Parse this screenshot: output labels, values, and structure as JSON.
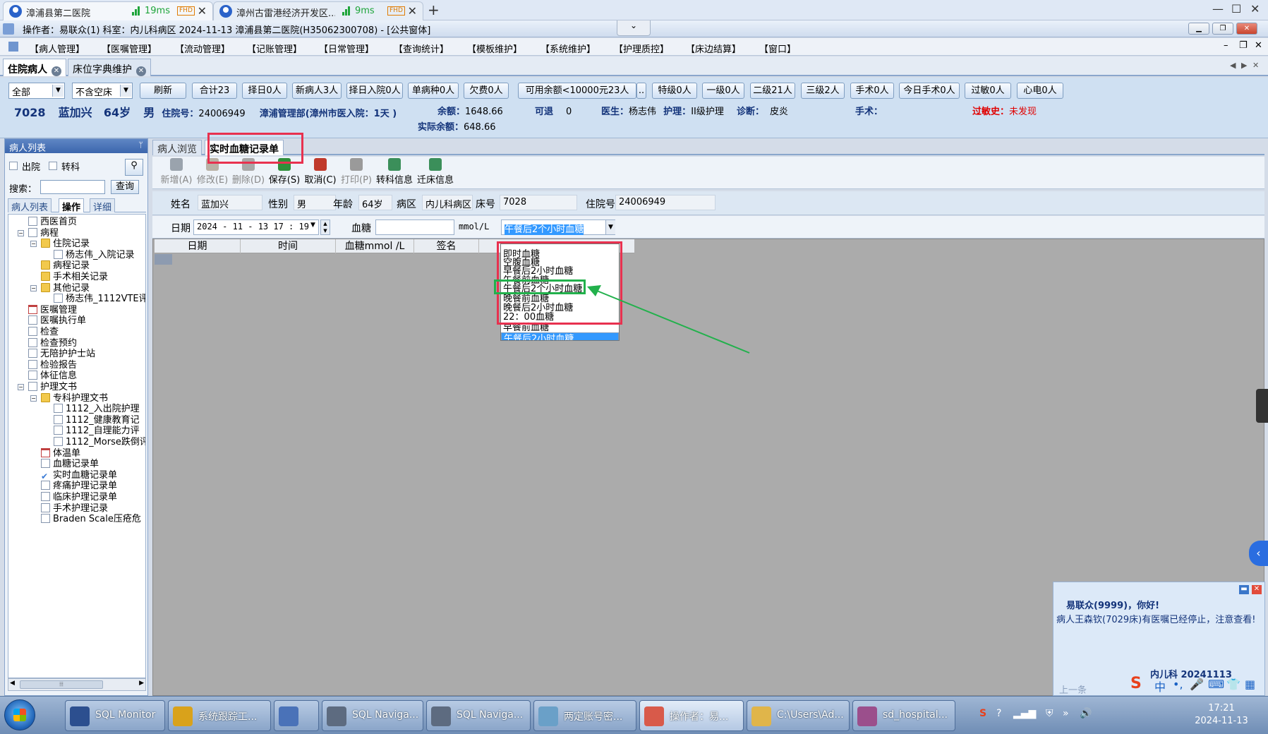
{
  "browser": {
    "tabs": [
      {
        "title": "漳浦县第二医院",
        "latency": "19ms",
        "quality": "FHD"
      },
      {
        "title": "漳州古雷港经济开发区...",
        "latency": "9ms",
        "quality": "FHD"
      }
    ],
    "new_tab": "+",
    "controls": {
      "minimize": "—",
      "maximize": "☐",
      "close": "✕"
    }
  },
  "app": {
    "title": "操作者：易联众(1)  科室：内儿科病区  2024-11-13  漳浦县第二医院(H35062300708) - [公共窗体]",
    "collapse": "⌄"
  },
  "menu": [
    "【病人管理】",
    "【医嘱管理】",
    "【流动管理】",
    "【记账管理】",
    "【日常管理】",
    "【查询统计】",
    "【模板维护】",
    "【系统维护】",
    "【护理质控】",
    "【床边结算】",
    "【窗口】"
  ],
  "menu_right": {
    "min": "–",
    "restore": "❐",
    "close": "✕"
  },
  "doc_tabs": [
    {
      "label": "住院病人",
      "close": "✕"
    },
    {
      "label": "床位字典维护",
      "close": "✕"
    }
  ],
  "doc_nav": {
    "left": "◀",
    "right": "▶",
    "close": "✕"
  },
  "filters": {
    "scope": "全部",
    "bed_filter": "不含空床",
    "buttons": [
      "刷新",
      "合计23",
      "择日0人",
      "新病人3人",
      "择日入院0人",
      "单病种0人",
      "欠费0人",
      "可用余额<10000元23人",
      "..",
      "特级0人",
      "一级0人",
      "二级21人",
      "三级2人",
      "手术0人",
      "今日手术0人",
      "过敏0人",
      "心电0人"
    ]
  },
  "patient_summary": {
    "bed": "7028",
    "name": "蓝加兴",
    "age": "64岁",
    "sex": "男",
    "admission_label": "住院号：",
    "admission_no": "24006949",
    "ward_info": "漳浦管理部(漳州市医入院：1天 )",
    "balance_label": "余额：",
    "balance": "1648.66",
    "actual_balance_label": "实际余额：",
    "actual_balance": "648.66",
    "refund_label": "可退",
    "refund": "0",
    "doctor_label": "医生：",
    "doctor": "杨志伟",
    "nursing_label": "护理：",
    "nursing": "II级护理",
    "diagnosis_label": "诊断：",
    "diagnosis": "皮炎",
    "surgery_label": "手术：",
    "allergy_label": "过敏史：",
    "allergy": "未发现"
  },
  "left_panel": {
    "header": "病人列表",
    "pin": "ᛘ",
    "chk_discharge": "出院",
    "chk_transfer": "转科",
    "search_label": "搜索：",
    "search_button": "查询",
    "tabs": [
      "病人列表",
      "操作",
      "详细"
    ],
    "tree": [
      {
        "label": "西医首页",
        "icon": "doc"
      },
      {
        "label": "病程",
        "icon": "doc"
      },
      {
        "label": "住院记录",
        "icon": "fold"
      },
      {
        "label": "杨志伟_入院记录",
        "icon": "doc"
      },
      {
        "label": "病程记录",
        "icon": "fold"
      },
      {
        "label": "手术相关记录",
        "icon": "fold"
      },
      {
        "label": "其他记录",
        "icon": "fold"
      },
      {
        "label": "杨志伟_1112VTE评",
        "icon": "doc"
      },
      {
        "label": "医嘱管理",
        "icon": "cal"
      },
      {
        "label": "医嘱执行单",
        "icon": "doc"
      },
      {
        "label": "检查",
        "icon": "doc"
      },
      {
        "label": "检查预约",
        "icon": "doc"
      },
      {
        "label": "无陪护护士站",
        "icon": "doc"
      },
      {
        "label": "检验报告",
        "icon": "doc"
      },
      {
        "label": "体征信息",
        "icon": "doc"
      },
      {
        "label": "护理文书",
        "icon": "doc"
      },
      {
        "label": "专科护理文书",
        "icon": "fold"
      },
      {
        "label": "1112_入出院护理",
        "icon": "doc"
      },
      {
        "label": "1112_健康教育记",
        "icon": "doc"
      },
      {
        "label": "1112_自理能力评",
        "icon": "doc"
      },
      {
        "label": "1112_Morse跌倒评",
        "icon": "doc"
      },
      {
        "label": "体温单",
        "icon": "cal"
      },
      {
        "label": "血糖记录单",
        "icon": "doc"
      },
      {
        "label": "实时血糖记录单",
        "icon": "chk"
      },
      {
        "label": "疼痛护理记录单",
        "icon": "doc"
      },
      {
        "label": "临床护理记录单",
        "icon": "doc"
      },
      {
        "label": "手术护理记录",
        "icon": "doc"
      },
      {
        "label": "Braden Scale压疮危",
        "icon": "doc"
      }
    ]
  },
  "main_tabs": [
    "病人浏览",
    "实时血糖记录单"
  ],
  "toolbar": [
    {
      "label": "新增(A)",
      "enabled": false,
      "color": "#9aa3ad"
    },
    {
      "label": "修改(E)",
      "enabled": false,
      "color": "#b9b2a6"
    },
    {
      "label": "删除(D)",
      "enabled": false,
      "color": "#a8a8a8"
    },
    {
      "label": "保存(S)",
      "enabled": true,
      "color": "#2f8f3a"
    },
    {
      "label": "取消(C)",
      "enabled": true,
      "color": "#c0392b"
    },
    {
      "label": "打印(P)",
      "enabled": false,
      "color": "#9a9a9a"
    },
    {
      "label": "转科信息",
      "enabled": true,
      "color": "#3b8f5a"
    },
    {
      "label": "迁床信息",
      "enabled": true,
      "color": "#3b8f5a"
    }
  ],
  "record_info": {
    "name_label": "姓名",
    "name": "蓝加兴",
    "sex_label": "性别",
    "sex": "男",
    "age_label": "年龄",
    "age": "64岁",
    "ward_label": "病区",
    "ward": "内儿科病区",
    "bed_label": "床号",
    "bed": "7028",
    "adm_label": "住院号",
    "adm": "24006949"
  },
  "entry": {
    "date_label": "日期",
    "date_value": "2024 - 11 - 13    17 : 19",
    "glucose_label": "血糖",
    "glucose_value": "",
    "unit": "mmol/L",
    "type_value": "午餐后2个小时血糖"
  },
  "grid": {
    "columns": [
      "日期",
      "时间",
      "血糖mmol /L",
      "签名"
    ]
  },
  "dropdown_options": [
    "即时血糖",
    "空腹血糖",
    "早餐后2小时血糖",
    "午餐前血糖",
    "午餐后2个小时血糖",
    "晚餐前血糖",
    "晚餐后2小时血糖",
    "22：00血糖",
    "早餐前血糖",
    "午餐后2小时血糖"
  ],
  "dropdown_selected_index": 9,
  "notification": {
    "greeting": "易联众(9999)，你好!",
    "message": "病人王森钦(7029床)有医嘱已经停止，注意查看!",
    "signature": "内儿科  20241113",
    "prev": "上一条"
  },
  "ime": [
    "S",
    "中",
    "•,",
    "🎤",
    "⌨",
    "👕",
    "▦"
  ],
  "taskbar": {
    "items": [
      "SQL Monitor",
      "系统跟踪工...",
      "",
      "SQL Naviga...",
      "SQL Naviga...",
      "两定账号密...",
      "操作者：易...",
      "C:\\Users\\Ad...",
      "sd_hospital..."
    ],
    "icon_colors": [
      "#2c4f8f",
      "#d9a21b",
      "#4a72b8",
      "#5d6b80",
      "#5d6b80",
      "#6aa0c8",
      "#d85a4a",
      "#e0b54a",
      "#9b4f8c"
    ],
    "time": "17:21",
    "date": "2024-11-13"
  },
  "annotation_colors": {
    "red": "#e8314f",
    "green": "#22b14c"
  }
}
